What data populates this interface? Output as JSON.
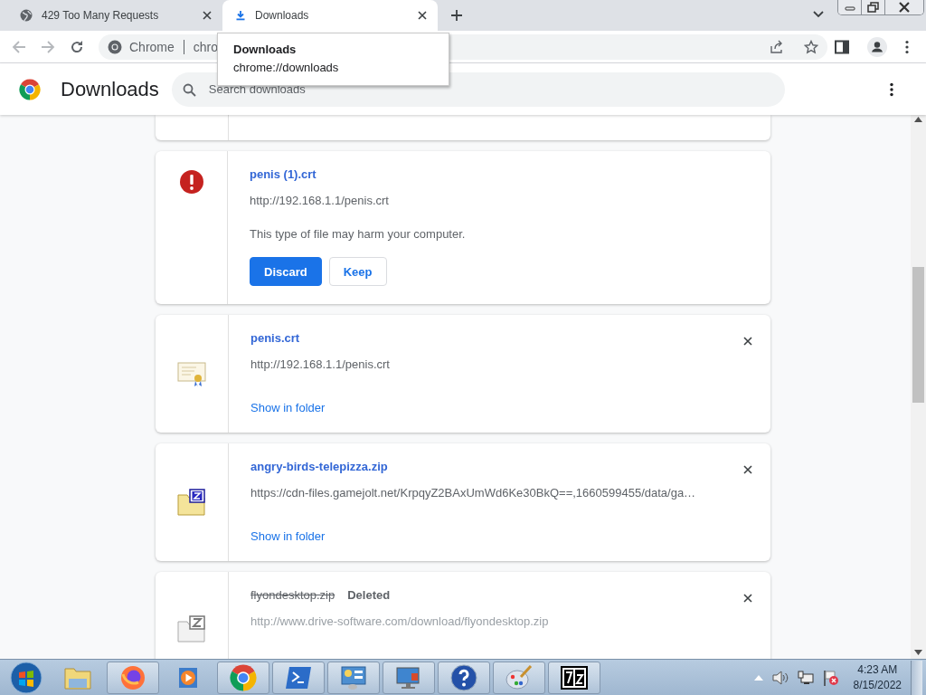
{
  "tabs": [
    {
      "title": "429 Too Many Requests",
      "selected": false
    },
    {
      "title": "Downloads",
      "selected": true
    }
  ],
  "omnibox": {
    "site_label": "Chrome",
    "url": "chro"
  },
  "tooltip": {
    "title": "Downloads",
    "url": "chrome://downloads"
  },
  "header": {
    "title": "Downloads",
    "search": {
      "placeholder": "Search downloads"
    }
  },
  "downloads": [
    {
      "kind": "dangerous",
      "name": "penis (1).crt",
      "url": "http://192.168.1.1/penis.crt",
      "warning": "This type of file may harm your computer.",
      "buttons": [
        "Discard",
        "Keep"
      ]
    },
    {
      "kind": "certificate",
      "name": "penis.crt",
      "url": "http://192.168.1.1/penis.crt",
      "link": "Show in folder"
    },
    {
      "kind": "archive",
      "name": "angry-birds-telepizza.zip",
      "url": "https://cdn-files.gamejolt.net/KrpqyZ2BAxUmWd6Ke30BkQ==,1660599455/data/ga…",
      "link": "Show in folder"
    },
    {
      "kind": "deleted",
      "name": "flyondesktop.zip",
      "status_label": "Deleted",
      "url": "http://www.drive-software.com/download/flyondesktop.zip"
    }
  ],
  "taskbar": {
    "time": "4:23 AM",
    "date": "8/15/2022"
  }
}
